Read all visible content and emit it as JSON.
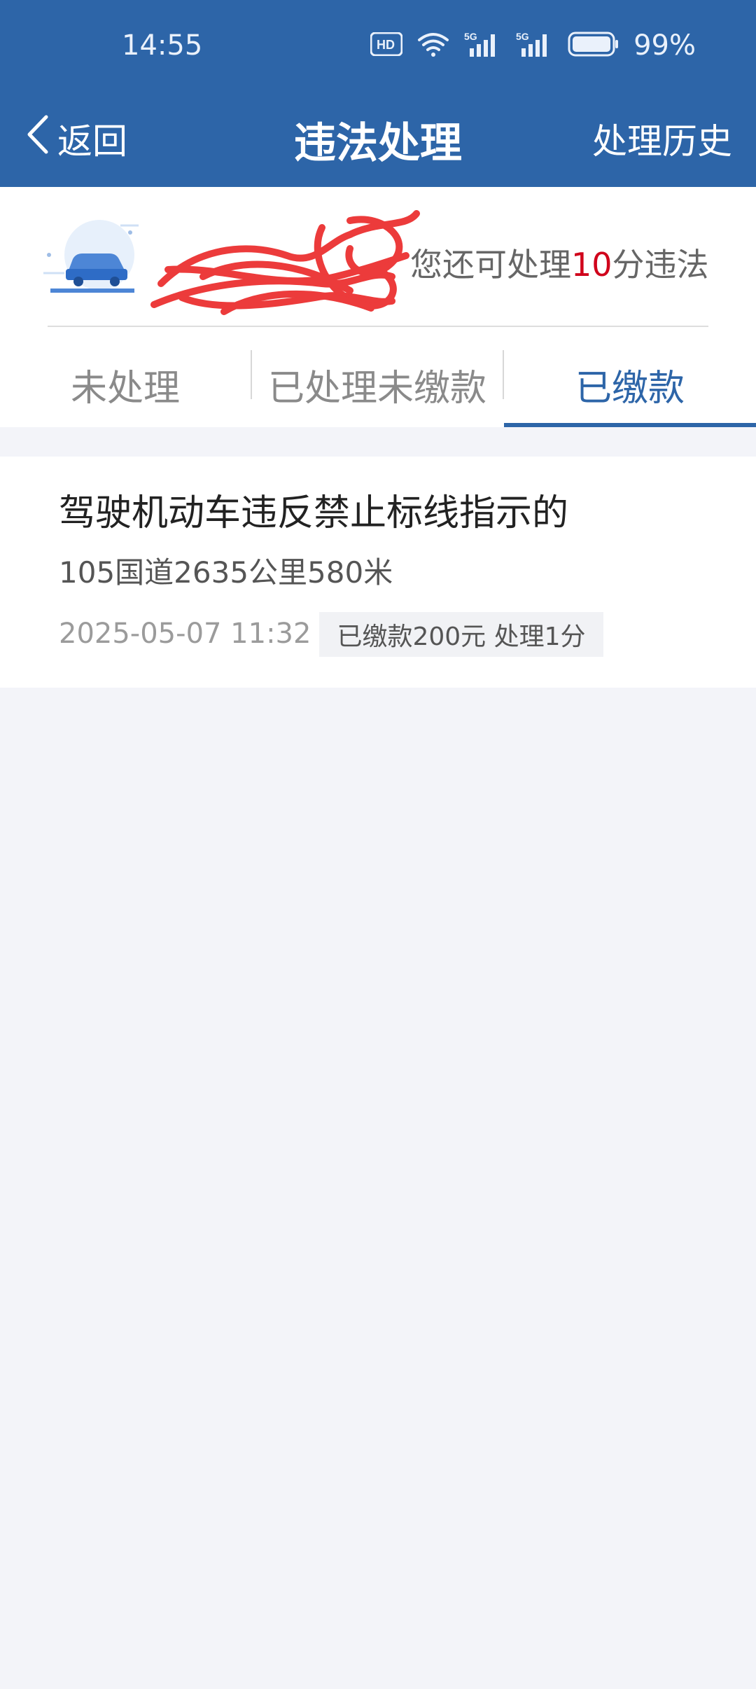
{
  "status_bar": {
    "time": "14:55",
    "battery_percent": "99%",
    "icons": [
      "hd-icon",
      "wifi-icon",
      "5g-signal-icon",
      "5g-signal-icon",
      "battery-icon"
    ]
  },
  "nav": {
    "back_label": "返回",
    "title": "违法处理",
    "history_label": "处理历史"
  },
  "header": {
    "remaining_prefix": "您还可处理",
    "remaining_points": "10",
    "remaining_suffix": "分违法"
  },
  "tabs": [
    {
      "label": "未处理",
      "active": false
    },
    {
      "label": "已处理未缴款",
      "active": false
    },
    {
      "label": "已缴款",
      "active": true
    }
  ],
  "records": [
    {
      "title": "驾驶机动车违反禁止标线指示的",
      "location": "105国道2635公里580米",
      "time": "2025-05-07 11:32",
      "status": "已缴款200元 处理1分"
    }
  ],
  "colors": {
    "primary": "#2d65a8",
    "highlight_red": "#d0021b",
    "page_bg": "#f3f4f9"
  }
}
